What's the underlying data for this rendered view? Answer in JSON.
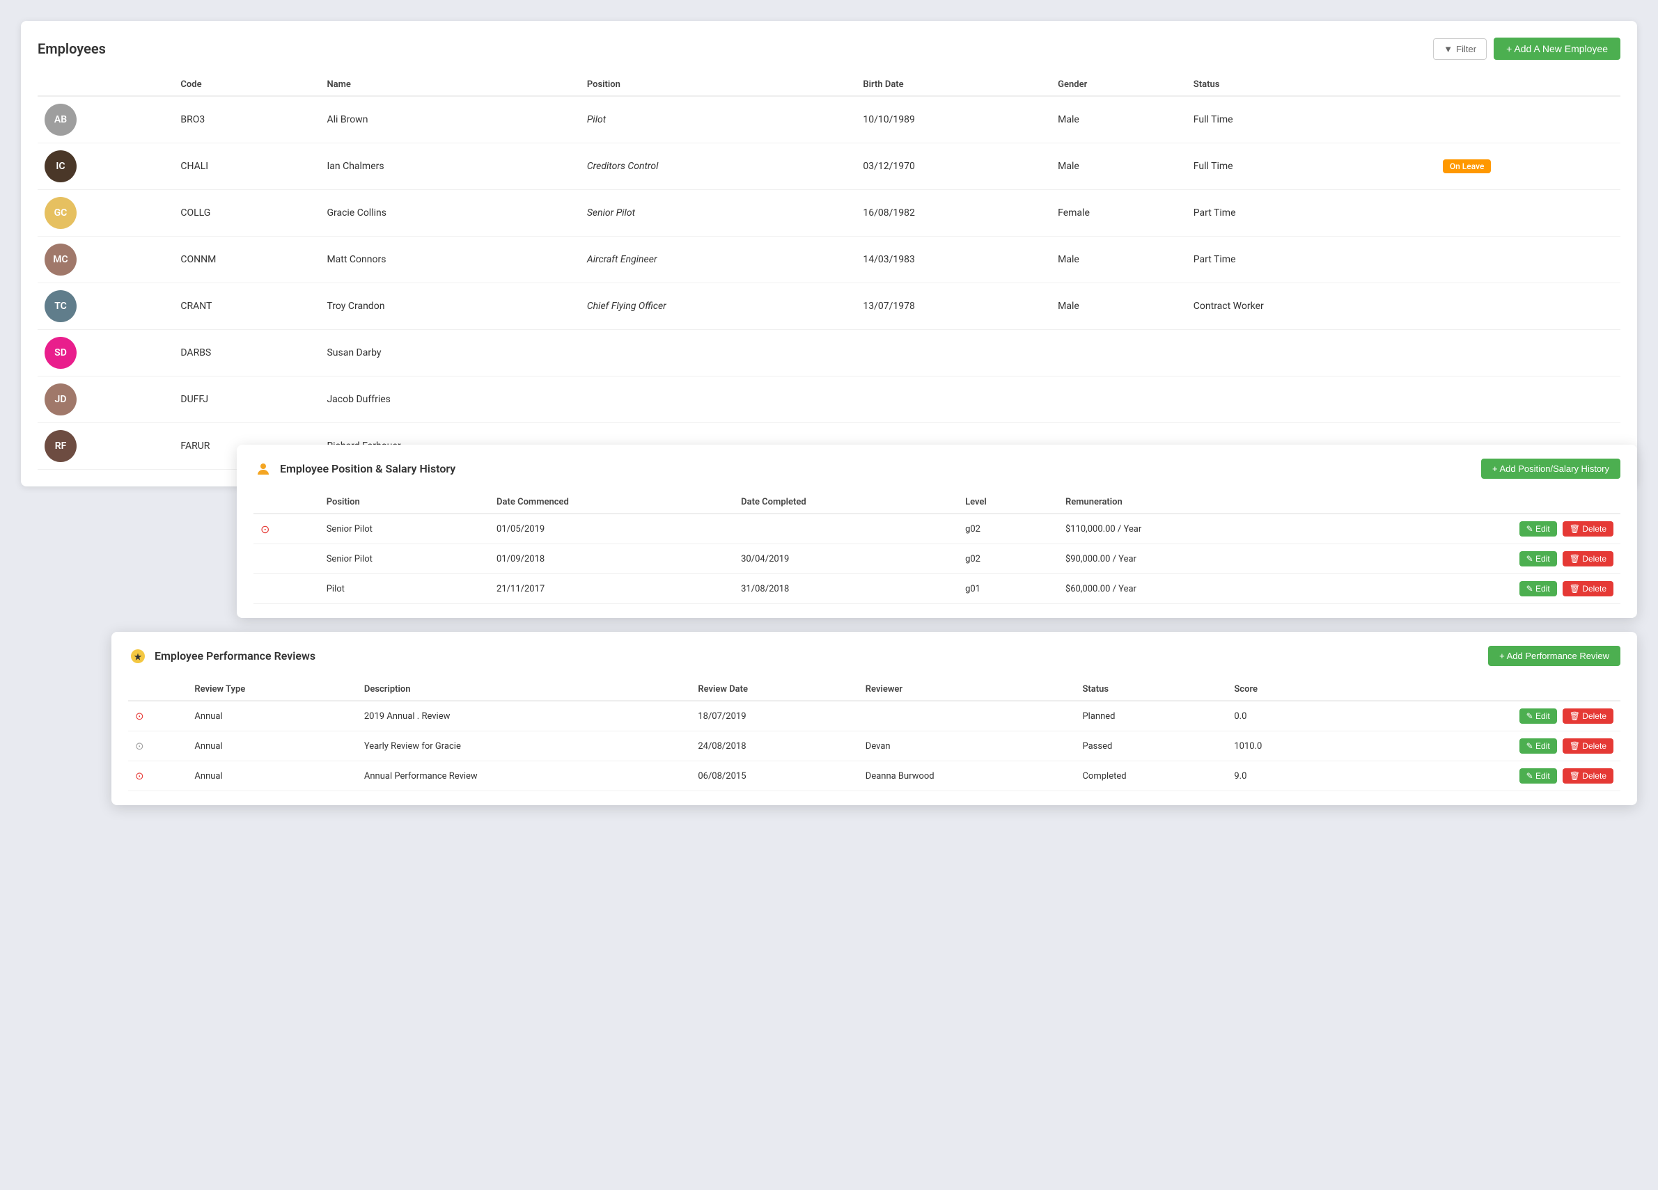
{
  "page": {
    "title": "Employees",
    "filter_label": "Filter",
    "add_employee_label": "+ Add A New Employee"
  },
  "employees_table": {
    "columns": [
      "Code",
      "Name",
      "Position",
      "Birth Date",
      "Gender",
      "Status"
    ],
    "rows": [
      {
        "id": 1,
        "code": "BRO3",
        "name": "Ali Brown",
        "position": "Pilot",
        "birth_date": "10/10/1989",
        "gender": "Male",
        "status": "Full Time",
        "badge": null,
        "avatar_color": "#9e9e9e",
        "avatar_text": "AB"
      },
      {
        "id": 2,
        "code": "CHALI",
        "name": "Ian Chalmers",
        "position": "Creditors Control",
        "birth_date": "03/12/1970",
        "gender": "Male",
        "status": "Full Time",
        "badge": "On Leave",
        "avatar_color": "#5d4037",
        "avatar_text": "IC"
      },
      {
        "id": 3,
        "code": "COLLG",
        "name": "Gracie Collins",
        "position": "Senior Pilot",
        "birth_date": "16/08/1982",
        "gender": "Female",
        "status": "Part Time",
        "badge": null,
        "avatar_color": "#f9a825",
        "avatar_text": "GC"
      },
      {
        "id": 4,
        "code": "CONNM",
        "name": "Matt Connors",
        "position": "Aircraft Engineer",
        "birth_date": "14/03/1983",
        "gender": "Male",
        "status": "Part Time",
        "badge": null,
        "avatar_color": "#8d6e63",
        "avatar_text": "MC"
      },
      {
        "id": 5,
        "code": "CRANT",
        "name": "Troy Crandon",
        "position": "Chief Flying Officer",
        "birth_date": "13/07/1978",
        "gender": "Male",
        "status": "Contract Worker",
        "badge": null,
        "avatar_color": "#78909c",
        "avatar_text": "TC"
      },
      {
        "id": 6,
        "code": "DARBS",
        "name": "Susan Darby",
        "position": "",
        "birth_date": "",
        "gender": "",
        "status": "",
        "badge": null,
        "avatar_color": "#ec407a",
        "avatar_text": "SD"
      },
      {
        "id": 7,
        "code": "DUFFJ",
        "name": "Jacob Duffries",
        "position": "",
        "birth_date": "",
        "gender": "",
        "status": "",
        "badge": null,
        "avatar_color": "#8d6e63",
        "avatar_text": "JD"
      },
      {
        "id": 8,
        "code": "FARUR",
        "name": "Richard Farhouer",
        "position": "",
        "birth_date": "",
        "gender": "",
        "status": "",
        "badge": null,
        "avatar_color": "#6d4c41",
        "avatar_text": "RF"
      }
    ]
  },
  "salary_panel": {
    "title": "Employee Position & Salary History",
    "add_label": "+ Add Position/Salary History",
    "columns": [
      "Position",
      "Date Commenced",
      "Date Completed",
      "Level",
      "Remuneration"
    ],
    "rows": [
      {
        "id": 1,
        "position": "Senior Pilot",
        "date_commenced": "01/05/2019",
        "date_completed": "",
        "level": "g02",
        "remuneration": "$110,000.00 / Year",
        "current": true
      },
      {
        "id": 2,
        "position": "Senior Pilot",
        "date_commenced": "01/09/2018",
        "date_completed": "30/04/2019",
        "level": "g02",
        "remuneration": "$90,000.00 / Year",
        "current": false
      },
      {
        "id": 3,
        "position": "Pilot",
        "date_commenced": "21/11/2017",
        "date_completed": "31/08/2018",
        "level": "g01",
        "remuneration": "$60,000.00 / Year",
        "current": false
      }
    ],
    "edit_label": "Edit",
    "delete_label": "Delete"
  },
  "reviews_panel": {
    "title": "Employee Performance Reviews",
    "add_label": "+ Add Performance Review",
    "columns": [
      "Review Type",
      "Description",
      "Review Date",
      "Reviewer",
      "Status",
      "Score"
    ],
    "rows": [
      {
        "id": 1,
        "review_type": "Annual",
        "description": "2019 Annual . Review",
        "review_date": "18/07/2019",
        "reviewer": "",
        "status": "Planned",
        "score": "0.0",
        "icon": "red"
      },
      {
        "id": 2,
        "review_type": "Annual",
        "description": "Yearly Review for Gracie",
        "review_date": "24/08/2018",
        "reviewer": "Devan",
        "status": "Passed",
        "score": "1010.0",
        "icon": "gray"
      },
      {
        "id": 3,
        "review_type": "Annual",
        "description": "Annual Performance Review",
        "review_date": "06/08/2015",
        "reviewer": "Deanna Burwood",
        "status": "Completed",
        "score": "9.0",
        "icon": "red"
      }
    ],
    "edit_label": "Edit",
    "delete_label": "Delete"
  }
}
